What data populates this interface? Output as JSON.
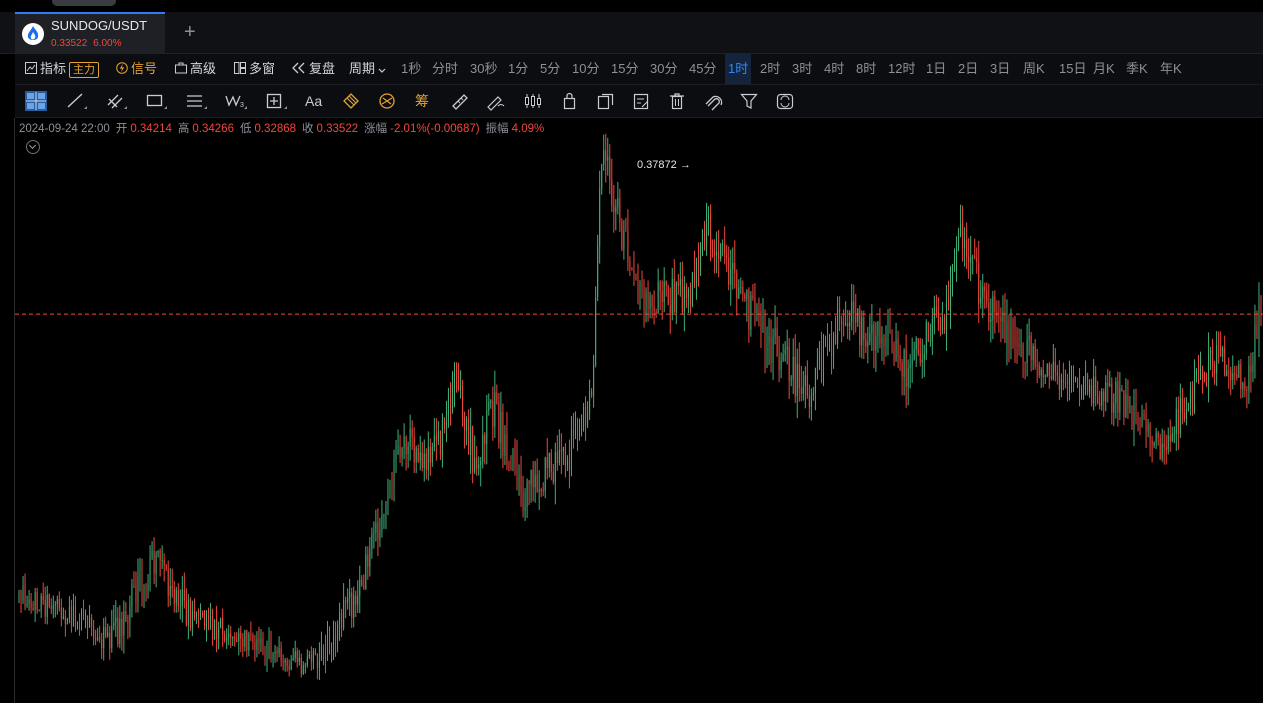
{
  "tab": {
    "symbol": "SUNDOG/USDT",
    "last_price": "0.33522",
    "change_pct": "6.00%",
    "add_label": "+"
  },
  "toolbar": {
    "indicators": "指标",
    "main_badge": "主力",
    "signal": "信号",
    "advanced": "高级",
    "multi_window": "多窗",
    "replay": "复盘",
    "period": "周期"
  },
  "periods": [
    {
      "label": "1秒",
      "active": false
    },
    {
      "label": "分时",
      "active": false
    },
    {
      "label": "30秒",
      "active": false
    },
    {
      "label": "1分",
      "active": false
    },
    {
      "label": "5分",
      "active": false
    },
    {
      "label": "10分",
      "active": false
    },
    {
      "label": "15分",
      "active": false
    },
    {
      "label": "30分",
      "active": false
    },
    {
      "label": "45分",
      "active": false
    },
    {
      "label": "1时",
      "active": true
    },
    {
      "label": "2时",
      "active": false
    },
    {
      "label": "3时",
      "active": false
    },
    {
      "label": "4时",
      "active": false
    },
    {
      "label": "8时",
      "active": false
    },
    {
      "label": "12时",
      "active": false
    },
    {
      "label": "1日",
      "active": false
    },
    {
      "label": "2日",
      "active": false
    },
    {
      "label": "3日",
      "active": false
    },
    {
      "label": "周K",
      "active": false
    },
    {
      "label": "15日",
      "active": false
    },
    {
      "label": "月K",
      "active": false
    },
    {
      "label": "季K",
      "active": false
    },
    {
      "label": "年K",
      "active": false
    }
  ],
  "drawing_tools": [
    "crosshair-icon",
    "trend-line-icon",
    "parallel-channel-icon",
    "rectangle-icon",
    "horizontal-lines-icon",
    "wave-pattern-icon",
    "measure-box-icon",
    "text-icon",
    "fibonacci-icon",
    "fib-circle-icon",
    "chip-distribution-icon",
    "ruler-icon",
    "brush-icon",
    "candle-settings-icon",
    "lock-icon",
    "copy-icon",
    "edit-icon",
    "delete-icon",
    "magnet-icon",
    "filter-icon",
    "sync-icon"
  ],
  "chip_label": "筹",
  "text_tool_label": "Aa",
  "ohlc": {
    "datetime": "2024-09-24 22:00",
    "open_label": "开",
    "open": "0.34214",
    "high_label": "高",
    "high": "0.34266",
    "low_label": "低",
    "low": "0.32868",
    "close_label": "收",
    "close": "0.33522",
    "change_label": "涨幅",
    "change": "-2.01%(-0.00687)",
    "amplitude_label": "振幅",
    "amplitude": "4.09%"
  },
  "chart_data": {
    "type": "candlestick",
    "interval": "1时",
    "high_marker_label": "0.37872 →",
    "last_price_line": 0.33522,
    "up_color": "#3fb07a",
    "down_color": "#f0473d",
    "price_line_color": "#f0473d",
    "ylim": [
      0.2415,
      0.3825
    ],
    "segments": [
      {
        "start": 0.268,
        "end": 0.262,
        "n": 28,
        "vol": 0.003
      },
      {
        "start": 0.262,
        "end": 0.256,
        "n": 18,
        "vol": 0.003
      },
      {
        "start": 0.256,
        "end": 0.276,
        "n": 22,
        "vol": 0.004
      },
      {
        "start": 0.276,
        "end": 0.262,
        "n": 18,
        "vol": 0.004
      },
      {
        "start": 0.262,
        "end": 0.25,
        "n": 60,
        "vol": 0.003
      },
      {
        "start": 0.25,
        "end": 0.27,
        "n": 25,
        "vol": 0.004
      },
      {
        "start": 0.27,
        "end": 0.305,
        "n": 20,
        "vol": 0.004
      },
      {
        "start": 0.305,
        "end": 0.3,
        "n": 15,
        "vol": 0.004
      },
      {
        "start": 0.3,
        "end": 0.318,
        "n": 12,
        "vol": 0.005
      },
      {
        "start": 0.318,
        "end": 0.298,
        "n": 10,
        "vol": 0.005
      },
      {
        "start": 0.298,
        "end": 0.313,
        "n": 8,
        "vol": 0.005
      },
      {
        "start": 0.313,
        "end": 0.292,
        "n": 14,
        "vol": 0.005
      },
      {
        "start": 0.292,
        "end": 0.303,
        "n": 25,
        "vol": 0.005
      },
      {
        "start": 0.303,
        "end": 0.315,
        "n": 10,
        "vol": 0.004
      },
      {
        "start": 0.315,
        "end": 0.374,
        "n": 5,
        "vol": 0.004
      },
      {
        "start": 0.374,
        "end": 0.339,
        "n": 18,
        "vol": 0.005
      },
      {
        "start": 0.339,
        "end": 0.34,
        "n": 25,
        "vol": 0.005
      },
      {
        "start": 0.34,
        "end": 0.357,
        "n": 10,
        "vol": 0.005
      },
      {
        "start": 0.357,
        "end": 0.337,
        "n": 18,
        "vol": 0.005
      },
      {
        "start": 0.337,
        "end": 0.325,
        "n": 18,
        "vol": 0.005
      },
      {
        "start": 0.325,
        "end": 0.315,
        "n": 14,
        "vol": 0.005
      },
      {
        "start": 0.315,
        "end": 0.335,
        "n": 15,
        "vol": 0.005
      },
      {
        "start": 0.335,
        "end": 0.33,
        "n": 20,
        "vol": 0.005
      },
      {
        "start": 0.33,
        "end": 0.322,
        "n": 14,
        "vol": 0.005
      },
      {
        "start": 0.322,
        "end": 0.336,
        "n": 18,
        "vol": 0.005
      },
      {
        "start": 0.336,
        "end": 0.355,
        "n": 8,
        "vol": 0.005
      },
      {
        "start": 0.355,
        "end": 0.338,
        "n": 12,
        "vol": 0.005
      },
      {
        "start": 0.338,
        "end": 0.327,
        "n": 20,
        "vol": 0.005
      },
      {
        "start": 0.327,
        "end": 0.318,
        "n": 22,
        "vol": 0.004
      },
      {
        "start": 0.318,
        "end": 0.315,
        "n": 25,
        "vol": 0.004
      },
      {
        "start": 0.315,
        "end": 0.302,
        "n": 20,
        "vol": 0.004
      },
      {
        "start": 0.302,
        "end": 0.313,
        "n": 12,
        "vol": 0.004
      },
      {
        "start": 0.313,
        "end": 0.325,
        "n": 14,
        "vol": 0.005
      },
      {
        "start": 0.325,
        "end": 0.32,
        "n": 18,
        "vol": 0.004
      },
      {
        "start": 0.32,
        "end": 0.336,
        "n": 6,
        "vol": 0.005
      }
    ]
  }
}
